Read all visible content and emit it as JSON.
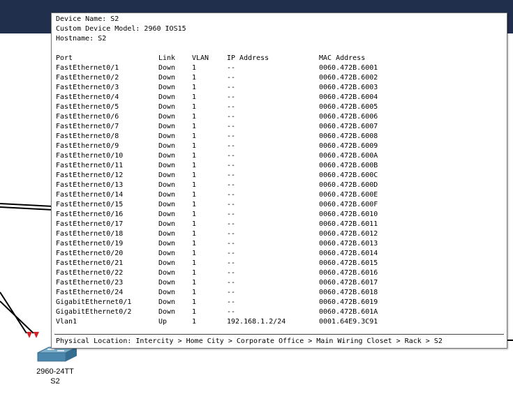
{
  "device": {
    "name_line": "Device Name: S2",
    "model_line": "Custom Device Model: 2960 IOS15",
    "hostname_line": "Hostname: S2"
  },
  "table": {
    "headers": {
      "port": "Port",
      "link": "Link",
      "vlan": "VLAN",
      "ip": "IP Address",
      "mac": "MAC Address"
    },
    "rows": [
      {
        "port": "FastEthernet0/1",
        "link": "Down",
        "vlan": "1",
        "ip": "--",
        "mac": "0060.472B.6001"
      },
      {
        "port": "FastEthernet0/2",
        "link": "Down",
        "vlan": "1",
        "ip": "--",
        "mac": "0060.472B.6002"
      },
      {
        "port": "FastEthernet0/3",
        "link": "Down",
        "vlan": "1",
        "ip": "--",
        "mac": "0060.472B.6003"
      },
      {
        "port": "FastEthernet0/4",
        "link": "Down",
        "vlan": "1",
        "ip": "--",
        "mac": "0060.472B.6004"
      },
      {
        "port": "FastEthernet0/5",
        "link": "Down",
        "vlan": "1",
        "ip": "--",
        "mac": "0060.472B.6005"
      },
      {
        "port": "FastEthernet0/6",
        "link": "Down",
        "vlan": "1",
        "ip": "--",
        "mac": "0060.472B.6006"
      },
      {
        "port": "FastEthernet0/7",
        "link": "Down",
        "vlan": "1",
        "ip": "--",
        "mac": "0060.472B.6007"
      },
      {
        "port": "FastEthernet0/8",
        "link": "Down",
        "vlan": "1",
        "ip": "--",
        "mac": "0060.472B.6008"
      },
      {
        "port": "FastEthernet0/9",
        "link": "Down",
        "vlan": "1",
        "ip": "--",
        "mac": "0060.472B.6009"
      },
      {
        "port": "FastEthernet0/10",
        "link": "Down",
        "vlan": "1",
        "ip": "--",
        "mac": "0060.472B.600A"
      },
      {
        "port": "FastEthernet0/11",
        "link": "Down",
        "vlan": "1",
        "ip": "--",
        "mac": "0060.472B.600B"
      },
      {
        "port": "FastEthernet0/12",
        "link": "Down",
        "vlan": "1",
        "ip": "--",
        "mac": "0060.472B.600C"
      },
      {
        "port": "FastEthernet0/13",
        "link": "Down",
        "vlan": "1",
        "ip": "--",
        "mac": "0060.472B.600D"
      },
      {
        "port": "FastEthernet0/14",
        "link": "Down",
        "vlan": "1",
        "ip": "--",
        "mac": "0060.472B.600E"
      },
      {
        "port": "FastEthernet0/15",
        "link": "Down",
        "vlan": "1",
        "ip": "--",
        "mac": "0060.472B.600F"
      },
      {
        "port": "FastEthernet0/16",
        "link": "Down",
        "vlan": "1",
        "ip": "--",
        "mac": "0060.472B.6010"
      },
      {
        "port": "FastEthernet0/17",
        "link": "Down",
        "vlan": "1",
        "ip": "--",
        "mac": "0060.472B.6011"
      },
      {
        "port": "FastEthernet0/18",
        "link": "Down",
        "vlan": "1",
        "ip": "--",
        "mac": "0060.472B.6012"
      },
      {
        "port": "FastEthernet0/19",
        "link": "Down",
        "vlan": "1",
        "ip": "--",
        "mac": "0060.472B.6013"
      },
      {
        "port": "FastEthernet0/20",
        "link": "Down",
        "vlan": "1",
        "ip": "--",
        "mac": "0060.472B.6014"
      },
      {
        "port": "FastEthernet0/21",
        "link": "Down",
        "vlan": "1",
        "ip": "--",
        "mac": "0060.472B.6015"
      },
      {
        "port": "FastEthernet0/22",
        "link": "Down",
        "vlan": "1",
        "ip": "--",
        "mac": "0060.472B.6016"
      },
      {
        "port": "FastEthernet0/23",
        "link": "Down",
        "vlan": "1",
        "ip": "--",
        "mac": "0060.472B.6017"
      },
      {
        "port": "FastEthernet0/24",
        "link": "Down",
        "vlan": "1",
        "ip": "--",
        "mac": "0060.472B.6018"
      },
      {
        "port": "GigabitEthernet0/1",
        "link": "Down",
        "vlan": "1",
        "ip": "--",
        "mac": "0060.472B.6019"
      },
      {
        "port": "GigabitEthernet0/2",
        "link": "Down",
        "vlan": "1",
        "ip": "--",
        "mac": "0060.472B.601A"
      },
      {
        "port": "Vlan1",
        "link": "Up",
        "vlan": "1",
        "ip": "192.168.1.2/24",
        "mac": "0001.64E9.3C91"
      }
    ]
  },
  "location_line": "Physical Location: Intercity > Home City > Corporate Office > Main Wiring Closet > Rack > S2",
  "switch_icon": {
    "model_label": "2960-24TT",
    "name_label": "S2",
    "icon": "switch-icon",
    "port_status_color": "#d6202a"
  },
  "colors": {
    "topbar": "#1f2f4c",
    "cable": "#000000"
  }
}
